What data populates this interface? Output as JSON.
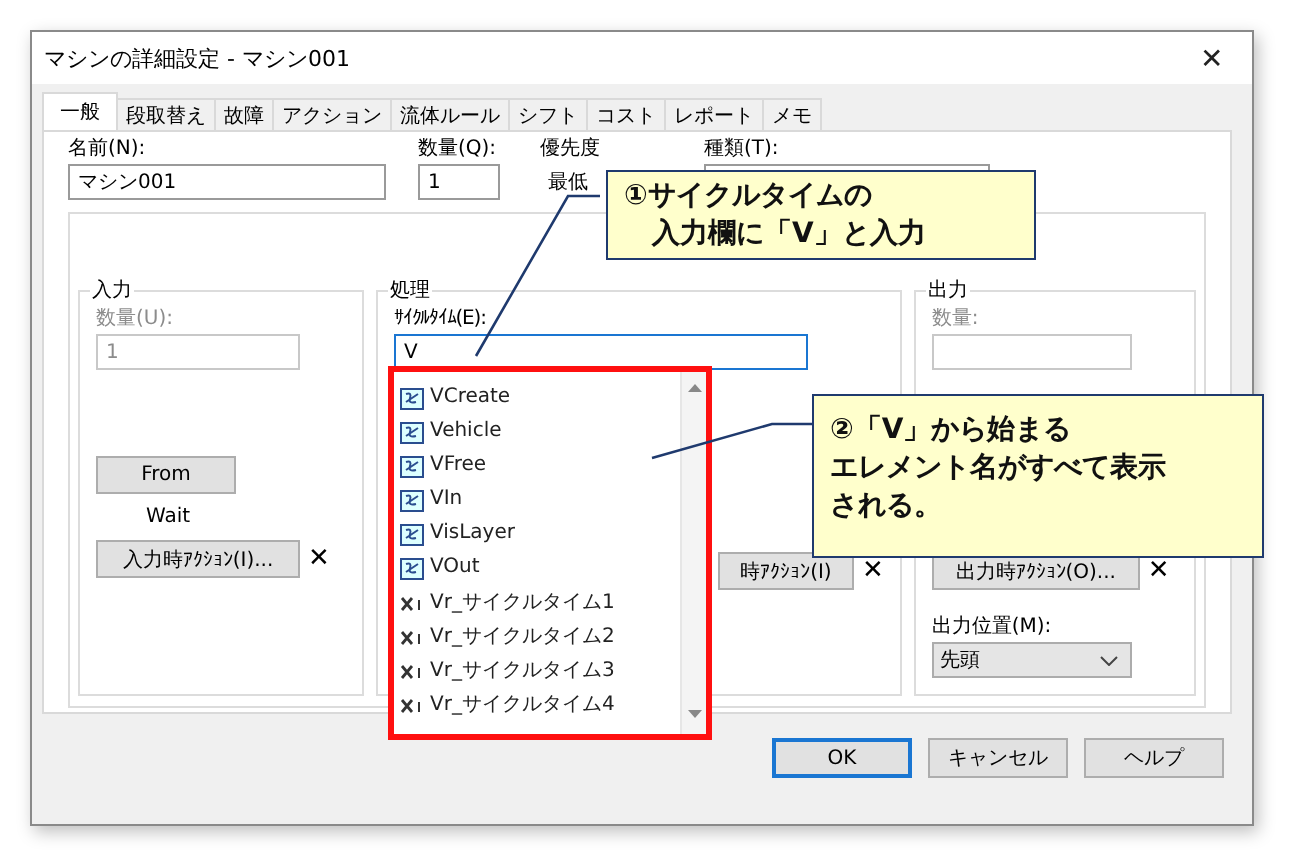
{
  "window": {
    "title": "マシンの詳細設定 - マシン001",
    "close": "✕"
  },
  "tabs": [
    {
      "label": "一般",
      "selected": true
    },
    {
      "label": "段取替え",
      "selected": false
    },
    {
      "label": "故障",
      "selected": false
    },
    {
      "label": "アクション",
      "selected": false
    },
    {
      "label": "流体ルール",
      "selected": false
    },
    {
      "label": "シフト",
      "selected": false
    },
    {
      "label": "コスト",
      "selected": false
    },
    {
      "label": "レポート",
      "selected": false
    },
    {
      "label": "メモ",
      "selected": false
    }
  ],
  "top_fields": {
    "name": {
      "label": "名前(N):",
      "value": "マシン001"
    },
    "quantity": {
      "label": "数量(Q):",
      "value": "1"
    },
    "priority": {
      "label": "優先度",
      "value": "最低"
    },
    "type": {
      "label": "種類(T):"
    }
  },
  "input_group": {
    "title": "入力",
    "quantity": {
      "label": "数量(U):",
      "value": "1",
      "disabled": true
    },
    "from_button": "From",
    "wait": "Wait",
    "action_button": "入力時ｱｸｼｮﾝ(I)...",
    "clear": "✕"
  },
  "process_group": {
    "title": "処理",
    "cycle_time": {
      "label": "ｻｲｸﾙﾀｲﾑ(E):",
      "value": "V"
    },
    "action_button": "時ｱｸｼｮﾝ(I)",
    "clear": "✕"
  },
  "output_group": {
    "title": "出力",
    "quantity": {
      "label": "数量:",
      "disabled": true
    },
    "action_button": "出力時ｱｸｼｮﾝ(O)...",
    "clear": "✕",
    "position": {
      "label": "出力位置(M):",
      "value": "先頭"
    }
  },
  "autocomplete": [
    {
      "kind": "element",
      "label": "VCreate"
    },
    {
      "kind": "element",
      "label": "Vehicle"
    },
    {
      "kind": "element",
      "label": "VFree"
    },
    {
      "kind": "element",
      "label": "VIn"
    },
    {
      "kind": "element",
      "label": "VisLayer"
    },
    {
      "kind": "element",
      "label": "VOut"
    },
    {
      "kind": "variable",
      "label": "Vr_サイクルタイム1"
    },
    {
      "kind": "variable",
      "label": "Vr_サイクルタイム2"
    },
    {
      "kind": "variable",
      "label": "Vr_サイクルタイム3"
    },
    {
      "kind": "variable",
      "label": "Vr_サイクルタイム4"
    }
  ],
  "buttons": [
    {
      "label": "OK",
      "selected": true
    },
    {
      "label": "キャンセル",
      "selected": false
    },
    {
      "label": "ヘルプ",
      "selected": false
    }
  ],
  "callouts": [
    {
      "lines": [
        "①サイクルタイムの",
        "　入力欄に「V」と入力"
      ]
    },
    {
      "lines": [
        "②「V」から始まる",
        "エレメント名がすべて表示",
        "される。"
      ]
    }
  ]
}
